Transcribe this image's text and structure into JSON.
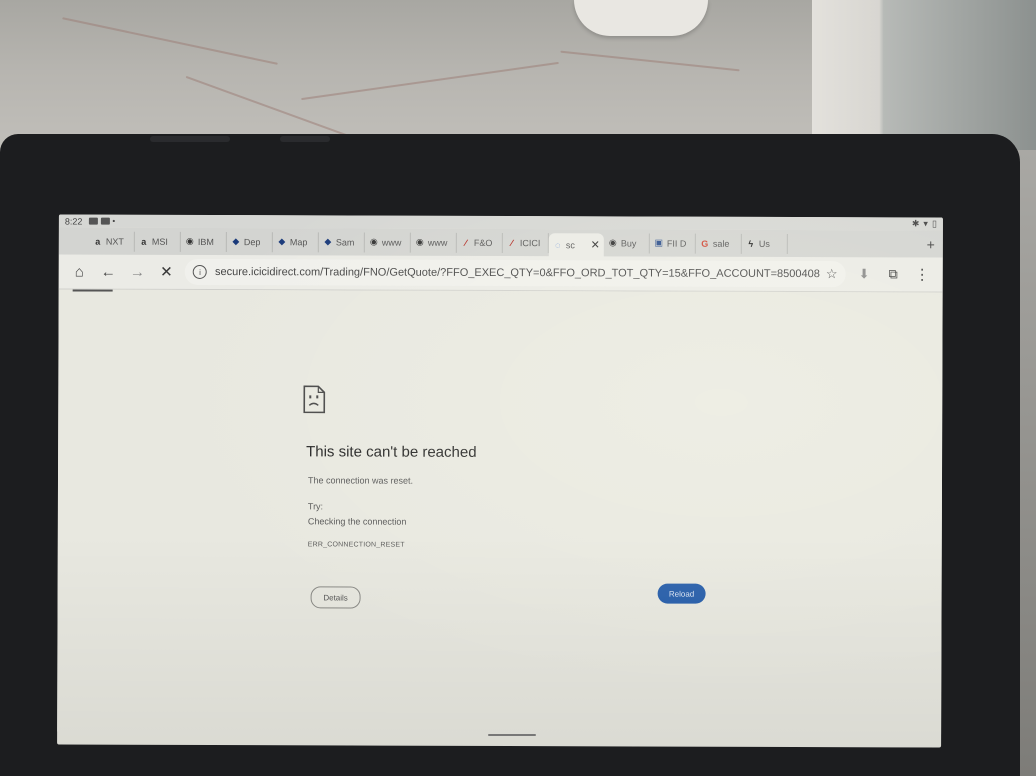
{
  "status_bar": {
    "time": "8:22",
    "icons": [
      "notification-icon",
      "notification-icon",
      "dot-icon"
    ],
    "right_icons": [
      "bluetooth-icon",
      "wifi-icon",
      "battery-icon"
    ]
  },
  "tabs": [
    {
      "label": "NXT",
      "icon": "amazon-icon",
      "glyph": "a"
    },
    {
      "label": "MSI",
      "icon": "amazon-icon",
      "glyph": "a"
    },
    {
      "label": "IBM",
      "icon": "globe-icon",
      "glyph": "◉"
    },
    {
      "label": "Dep",
      "icon": "diamond-icon",
      "glyph": "◆"
    },
    {
      "label": "Map",
      "icon": "diamond-icon",
      "glyph": "◆"
    },
    {
      "label": "Sam",
      "icon": "diamond-icon",
      "glyph": "◆"
    },
    {
      "label": "www",
      "icon": "globe-icon",
      "glyph": "◉"
    },
    {
      "label": "www",
      "icon": "globe-icon",
      "glyph": "◉"
    },
    {
      "label": "F&O",
      "icon": "icici-icon",
      "glyph": "⁄"
    },
    {
      "label": "ICICI",
      "icon": "icici-icon",
      "glyph": "⁄"
    },
    {
      "label": "sc",
      "icon": "loading-icon",
      "glyph": "◌",
      "active": true
    },
    {
      "label": "Buy",
      "icon": "globe-icon",
      "glyph": "◉"
    },
    {
      "label": "FII D",
      "icon": "page-icon",
      "glyph": "▣"
    },
    {
      "label": "sale",
      "icon": "google-icon",
      "glyph": "G"
    },
    {
      "label": "Us",
      "icon": "bolt-icon",
      "glyph": "ϟ"
    }
  ],
  "toolbar": {
    "url": "secure.icicidirect.com/Trading/FNO/GetQuote/?FFO_EXEC_QTY=0&FFO_ORD_TOT_QTY=15&FFO_ACCOUNT=8500408",
    "home_glyph": "⌂",
    "back_glyph": "←",
    "forward_glyph": "→",
    "stop_glyph": "✕",
    "star_glyph": "☆",
    "download_glyph": "⬇",
    "tabs_glyph": "⧉",
    "menu_glyph": "⋮",
    "new_tab_glyph": "+",
    "close_tab_glyph": "✕"
  },
  "error": {
    "title": "This site can't be reached",
    "message": "The connection was reset.",
    "try_label": "Try:",
    "suggestion": "Checking the connection",
    "code": "ERR_CONNECTION_RESET",
    "details_label": "Details",
    "reload_label": "Reload"
  },
  "colors": {
    "reload_button": "#1d57a8",
    "page_background": "#e8e8e0",
    "tablet_case": "#1c1d1f"
  }
}
